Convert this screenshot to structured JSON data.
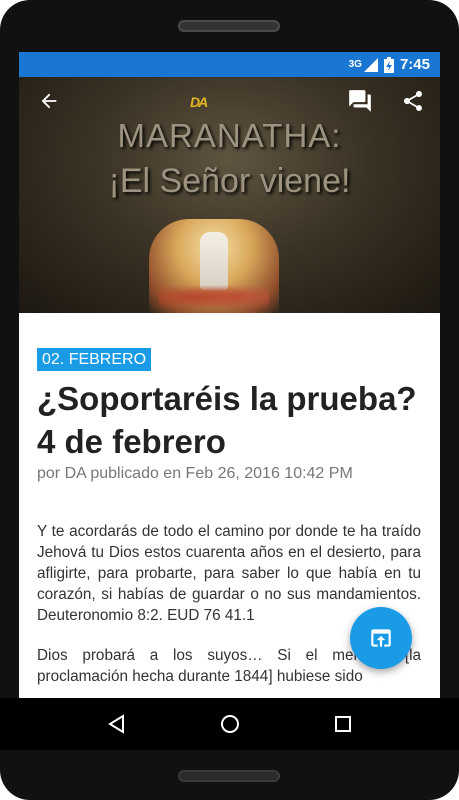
{
  "status_bar": {
    "network": "3G",
    "time": "7:45"
  },
  "hero": {
    "logo_text": "DA",
    "title_line1": "MARANATHA:",
    "title_line2": "¡El Señor viene!"
  },
  "appbar": {
    "icons": [
      "back-arrow-icon",
      "comments-icon",
      "share-icon"
    ]
  },
  "article": {
    "category": "02. FEBRERO",
    "title": "¿Soportaréis la prueba? 4 de febrero",
    "byline": "por DA publicado en Feb 26, 2016 10:42 PM",
    "paragraphs": [
      "Y te acordarás de todo el camino por donde te ha traído Jehová tu Dios estos cuarenta años en el desierto, para afligirte, para probarte, para saber lo que había en tu corazón, si habías de guardar o no sus mandamientos. Deuteronomio 8:2. EUD 76 41.1",
      "Dios probará a los suyos… Si el mensaje [la proclamación hecha durante 1844] hubiese sido"
    ]
  },
  "fab": {
    "icon": "open-in-browser-icon"
  },
  "nav": {
    "icons": [
      "back-triangle-icon",
      "home-circle-icon",
      "recents-square-icon"
    ]
  },
  "colors": {
    "status_bar": "#1976d2",
    "accent": "#1a9be6"
  }
}
